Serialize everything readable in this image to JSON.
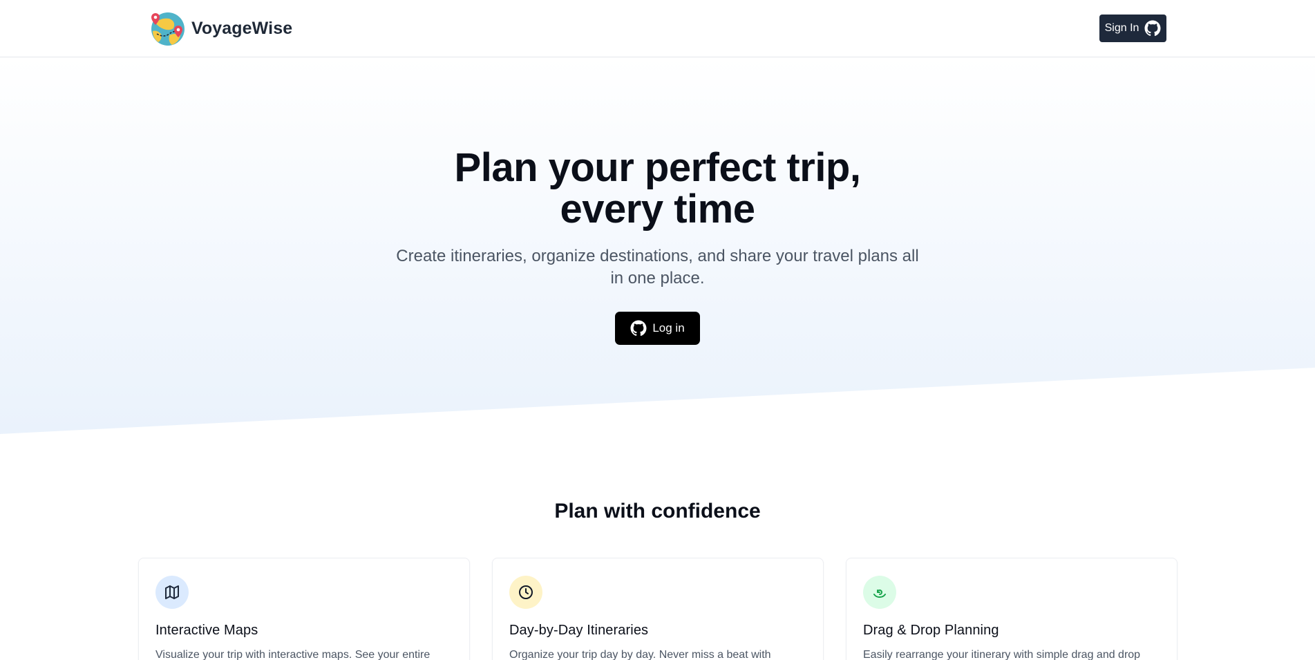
{
  "header": {
    "brand_name": "VoyageWise",
    "signin_label": "Sign In"
  },
  "hero": {
    "title_line1": "Plan your perfect trip,",
    "title_line2": "every time",
    "subtitle_line1": "Create itineraries, organize destinations, and share your travel plans all",
    "subtitle_line2": "in one place.",
    "login_label": "Log in"
  },
  "features": {
    "heading": "Plan with confidence",
    "cards": [
      {
        "title": "Interactive Maps",
        "description": "Visualize your trip with interactive maps. See your entire",
        "icon": "map-icon",
        "icon_bg": "#dbeafe",
        "icon_color": "#1e293b"
      },
      {
        "title": "Day-by-Day Itineraries",
        "description": "Organize your trip day by day. Never miss a beat with",
        "icon": "clock-icon",
        "icon_bg": "#fef3c7",
        "icon_color": "#111827"
      },
      {
        "title": "Drag & Drop Planning",
        "description": "Easily rearrange your itinerary with simple drag and drop",
        "icon": "undo-arrow-icon",
        "icon_bg": "#dcfce7",
        "icon_color": "#16a34a"
      }
    ]
  },
  "colors": {
    "signin_bg": "#1e293b",
    "login_bg": "#000000",
    "hero_gradient_bottom": "#eef4fd"
  }
}
